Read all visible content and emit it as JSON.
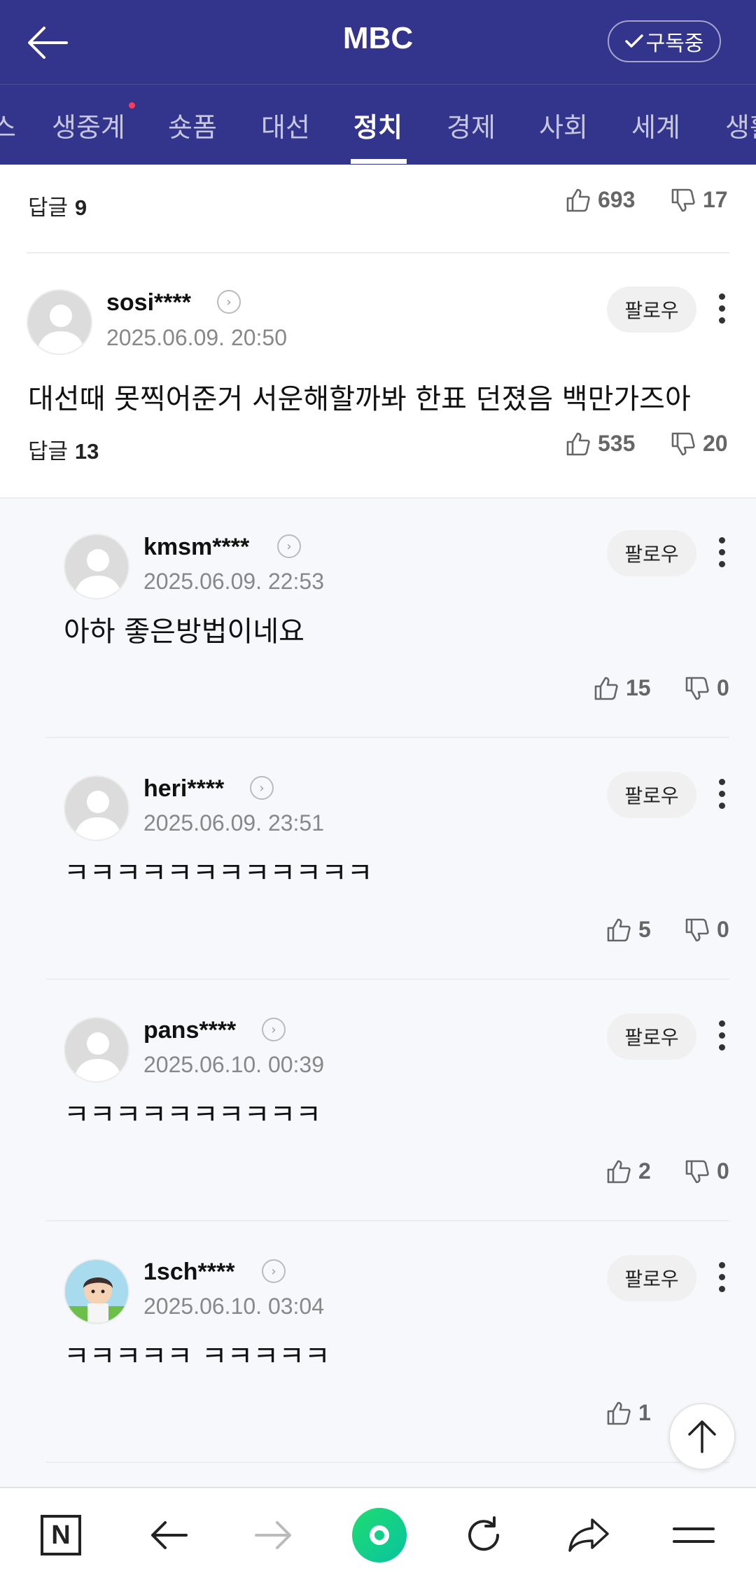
{
  "header": {
    "title": "MBC",
    "subscribe_label": "구독중"
  },
  "tabs": [
    {
      "label": "스"
    },
    {
      "label": "생중계"
    },
    {
      "label": "숏폼"
    },
    {
      "label": "대선"
    },
    {
      "label": "정치"
    },
    {
      "label": "경제"
    },
    {
      "label": "사회"
    },
    {
      "label": "세계"
    },
    {
      "label": "생활"
    }
  ],
  "active_tab": "정치",
  "reply_prefix": "답글",
  "follow_label": "팔로우",
  "top_summary": {
    "replies": "9",
    "likes": "693",
    "dislikes": "17"
  },
  "main_comment": {
    "username": "sosi****",
    "date": "2025.06.09. 20:50",
    "text": "대선때 못찍어준거 서운해할까봐 한표 던졌음 백만가즈아",
    "replies": "13",
    "likes": "535",
    "dislikes": "20"
  },
  "replies": [
    {
      "username": "kmsm****",
      "date": "2025.06.09. 22:53",
      "text": "아하 좋은방법이네요",
      "likes": "15",
      "dislikes": "0"
    },
    {
      "username": "heri****",
      "date": "2025.06.09. 23:51",
      "text": "ㅋㅋㅋㅋㅋㅋㅋㅋㅋㅋㅋㅋ",
      "likes": "5",
      "dislikes": "0"
    },
    {
      "username": "pans****",
      "date": "2025.06.10. 00:39",
      "text": "ㅋㅋㅋㅋㅋㅋㅋㅋㅋㅋ",
      "likes": "2",
      "dislikes": "0"
    },
    {
      "username": "1sch****",
      "date": "2025.06.10. 03:04",
      "text": "ㅋㅋㅋㅋㅋ ㅋㅋㅋㅋㅋ",
      "likes": "1",
      "dislikes": ""
    }
  ],
  "colors": {
    "header_bg": "#33348c",
    "accent_green": "#1fdc6f",
    "new_dot": "#ff3b5c"
  },
  "icons": [
    "back-arrow-icon",
    "check-icon",
    "thumbs-up-icon",
    "thumbs-down-icon",
    "chevron-right-icon",
    "more-vertical-icon",
    "arrow-up-icon",
    "naver-n-icon",
    "nav-back-icon",
    "nav-forward-icon",
    "green-dot-icon",
    "refresh-icon",
    "share-icon",
    "menu-icon"
  ]
}
